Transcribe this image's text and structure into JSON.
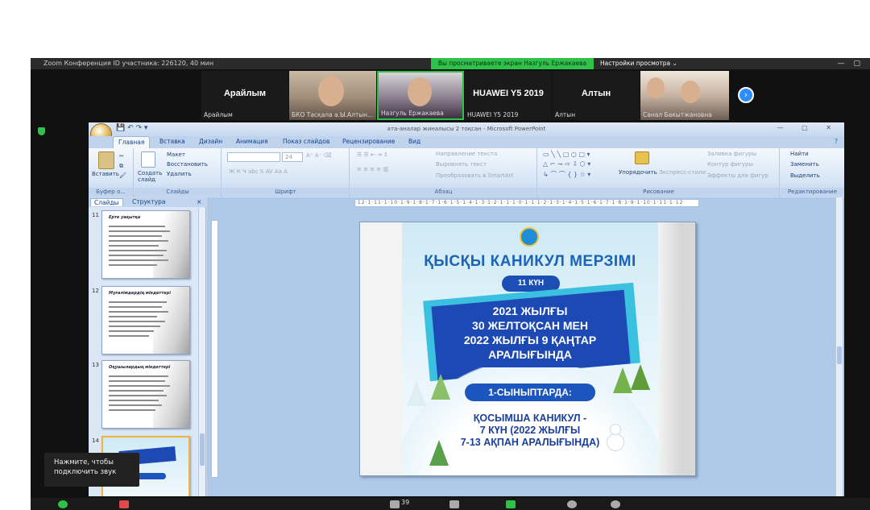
{
  "zoom": {
    "window_title": "Zoom Конференция  ID участника: 226120, 40 мин",
    "share_banner": "Вы просматриваете экран Назгуль Ержакаева",
    "view_options": "Настройки просмотра ⌄",
    "participant_count": "39",
    "tooltip": [
      "Нажмите, чтобы",
      "подключить звук"
    ],
    "participants": [
      {
        "big": "Арайлым",
        "small": "Арайлым"
      },
      {
        "big": "",
        "small": "БКО Тасқала а.Ы.Алтын..."
      },
      {
        "big": "",
        "small": "Назгуль Ержакаева"
      },
      {
        "big": "HUAWEI Y5 2019",
        "small": "HUAWEI Y5 2019"
      },
      {
        "big": "Алтын",
        "small": "Алтын"
      },
      {
        "big": "",
        "small": "Санал Бакытжановна"
      }
    ]
  },
  "ppt": {
    "title": "ата-аналар жиналысы 2 тоқсан - Microsoft PowerPoint",
    "tabs": [
      "Главная",
      "Вставка",
      "Дизайн",
      "Анимация",
      "Показ слайдов",
      "Рецензирование",
      "Вид"
    ],
    "ribbon": {
      "groups": [
        "Буфер о...",
        "Слайды",
        "Шрифт",
        "Абзац",
        "Рисование",
        "Редактирование"
      ],
      "paste": "Вставить",
      "create_slide": "Создать слайд",
      "layout": "Макет",
      "reset": "Восстановить",
      "delete": "Удалить",
      "font_size": "24",
      "text_direction": "Направление текста",
      "align_text": "Выровнять текст",
      "smartart": "Преобразовать в SmartArt",
      "arrange": "Упорядочить",
      "quick_styles": "Экспресс-стили",
      "shape_fill": "Заливка фигуры",
      "shape_outline": "Контур фигуры",
      "shape_effects": "Эффекты для фигур",
      "find": "Найти",
      "replace": "Заменить",
      "select": "Выделить"
    },
    "pane_tabs": [
      "Слайды",
      "Структура"
    ],
    "thumbnails": [
      {
        "num": "11",
        "title": "Ерте уақытқа"
      },
      {
        "num": "12",
        "title": "Мұғалімдердің міндеттері"
      },
      {
        "num": "13",
        "title": "Оқушылардың міндеттері"
      },
      {
        "num": "14",
        "title": ""
      }
    ],
    "ruler": "·12·1·11·1·10·1·9·1·8·1·7·1·6·1·5·1·4·1·3·1·2·1·1·1·0·1·1·1·2·1·3·1·4·1·5·1·6·1·7·1·8·1·9·1·10·1·11·1·12·",
    "poster": {
      "title": "ҚЫСҚЫ КАНИКУЛ МЕРЗІМІ",
      "badge": "11 КҮН",
      "banner_lines": [
        "2021 ЖЫЛҒЫ",
        "30 ЖЕЛТОҚСАН МЕН",
        "2022 ЖЫЛҒЫ 9 ҚАҢТАР",
        "АРАЛЫҒЫНДА"
      ],
      "pill": "1-СЫНЫПТАРДА:",
      "extra_lines": [
        "ҚОСЫМША КАНИКУЛ -",
        "7 КҮН (2022 ЖЫЛҒЫ",
        "7-13 АҚПАН АРАЛЫҒЫНДА)"
      ]
    }
  }
}
